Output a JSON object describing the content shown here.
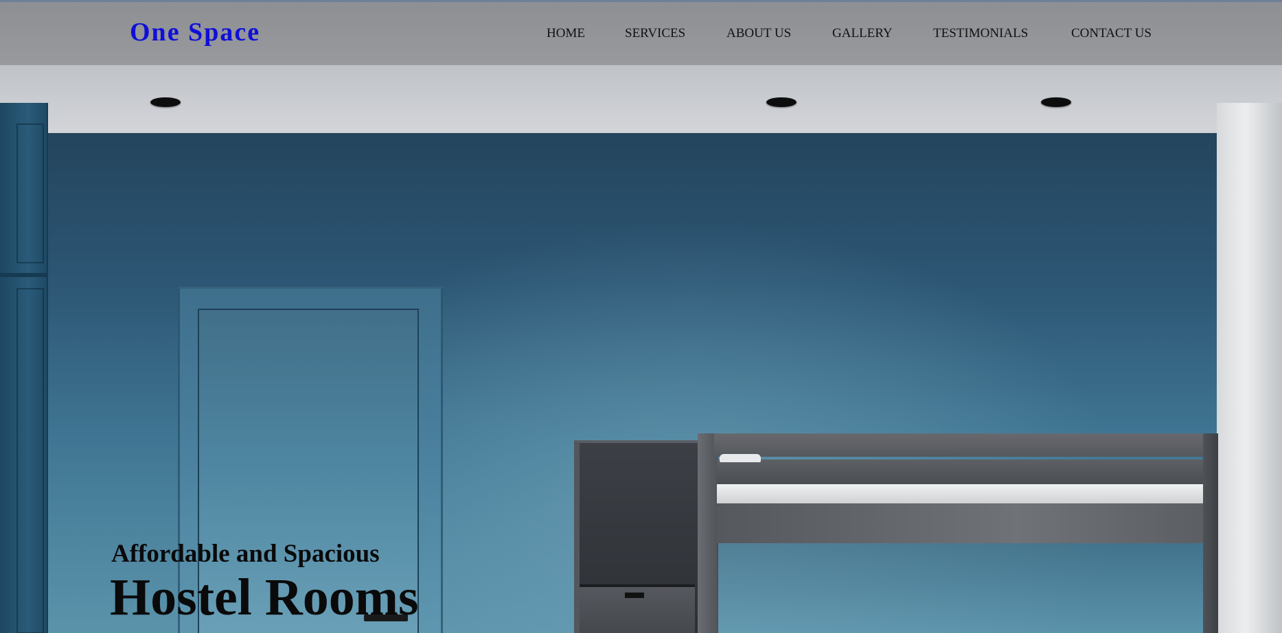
{
  "brand": {
    "name": "One Space",
    "color": "#0f0fd8"
  },
  "nav": {
    "items": [
      {
        "label": "HOME"
      },
      {
        "label": "SERVICES"
      },
      {
        "label": "ABOUT US"
      },
      {
        "label": "GALLERY"
      },
      {
        "label": "TESTIMONIALS"
      },
      {
        "label": "CONTACT US"
      }
    ]
  },
  "hero": {
    "subtitle": "Affordable and Spacious",
    "title": "Hostel Rooms"
  }
}
